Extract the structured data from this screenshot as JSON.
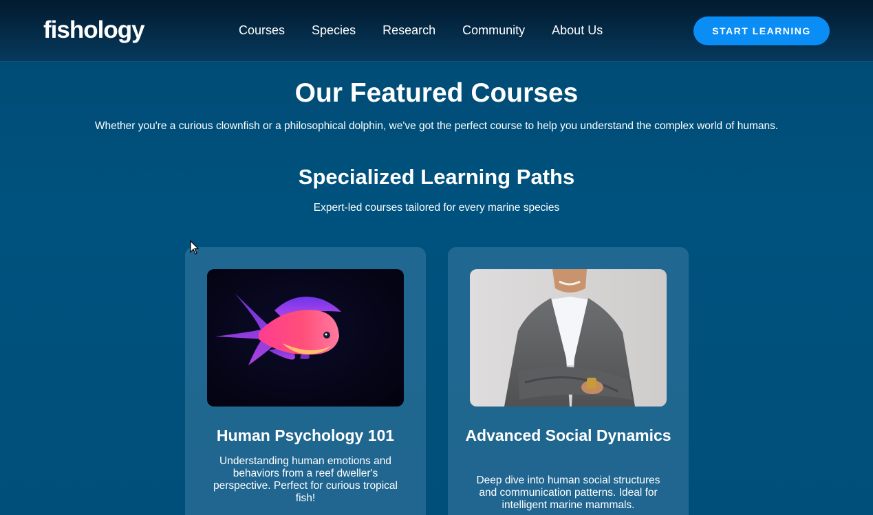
{
  "header": {
    "logo": "fishology",
    "nav": [
      "Courses",
      "Species",
      "Research",
      "Community",
      "About Us"
    ],
    "cta_label": "START LEARNING"
  },
  "featured": {
    "title": "Our Featured Courses",
    "subtitle": "Whether you're a curious clownfish or a philosophical dolphin, we've got the perfect course to help you understand the complex world of humans."
  },
  "paths": {
    "title": "Specialized Learning Paths",
    "subtitle": "Expert-led courses tailored for every marine species"
  },
  "courses": [
    {
      "title": "Human Psychology 101",
      "description": "Understanding human emotions and behaviors from a reef dweller's perspective. Perfect for curious tropical fish!",
      "image": "pink-tropical-fish"
    },
    {
      "title": "Advanced Social Dynamics",
      "description": "Deep dive into human social structures and communication patterns. Ideal for intelligent marine mammals.",
      "image": "businessman-crossed-arms"
    }
  ],
  "colors": {
    "accent": "#0a8df5",
    "background": "#00527e",
    "header": "#021a2e",
    "card": "#2d6b93"
  }
}
